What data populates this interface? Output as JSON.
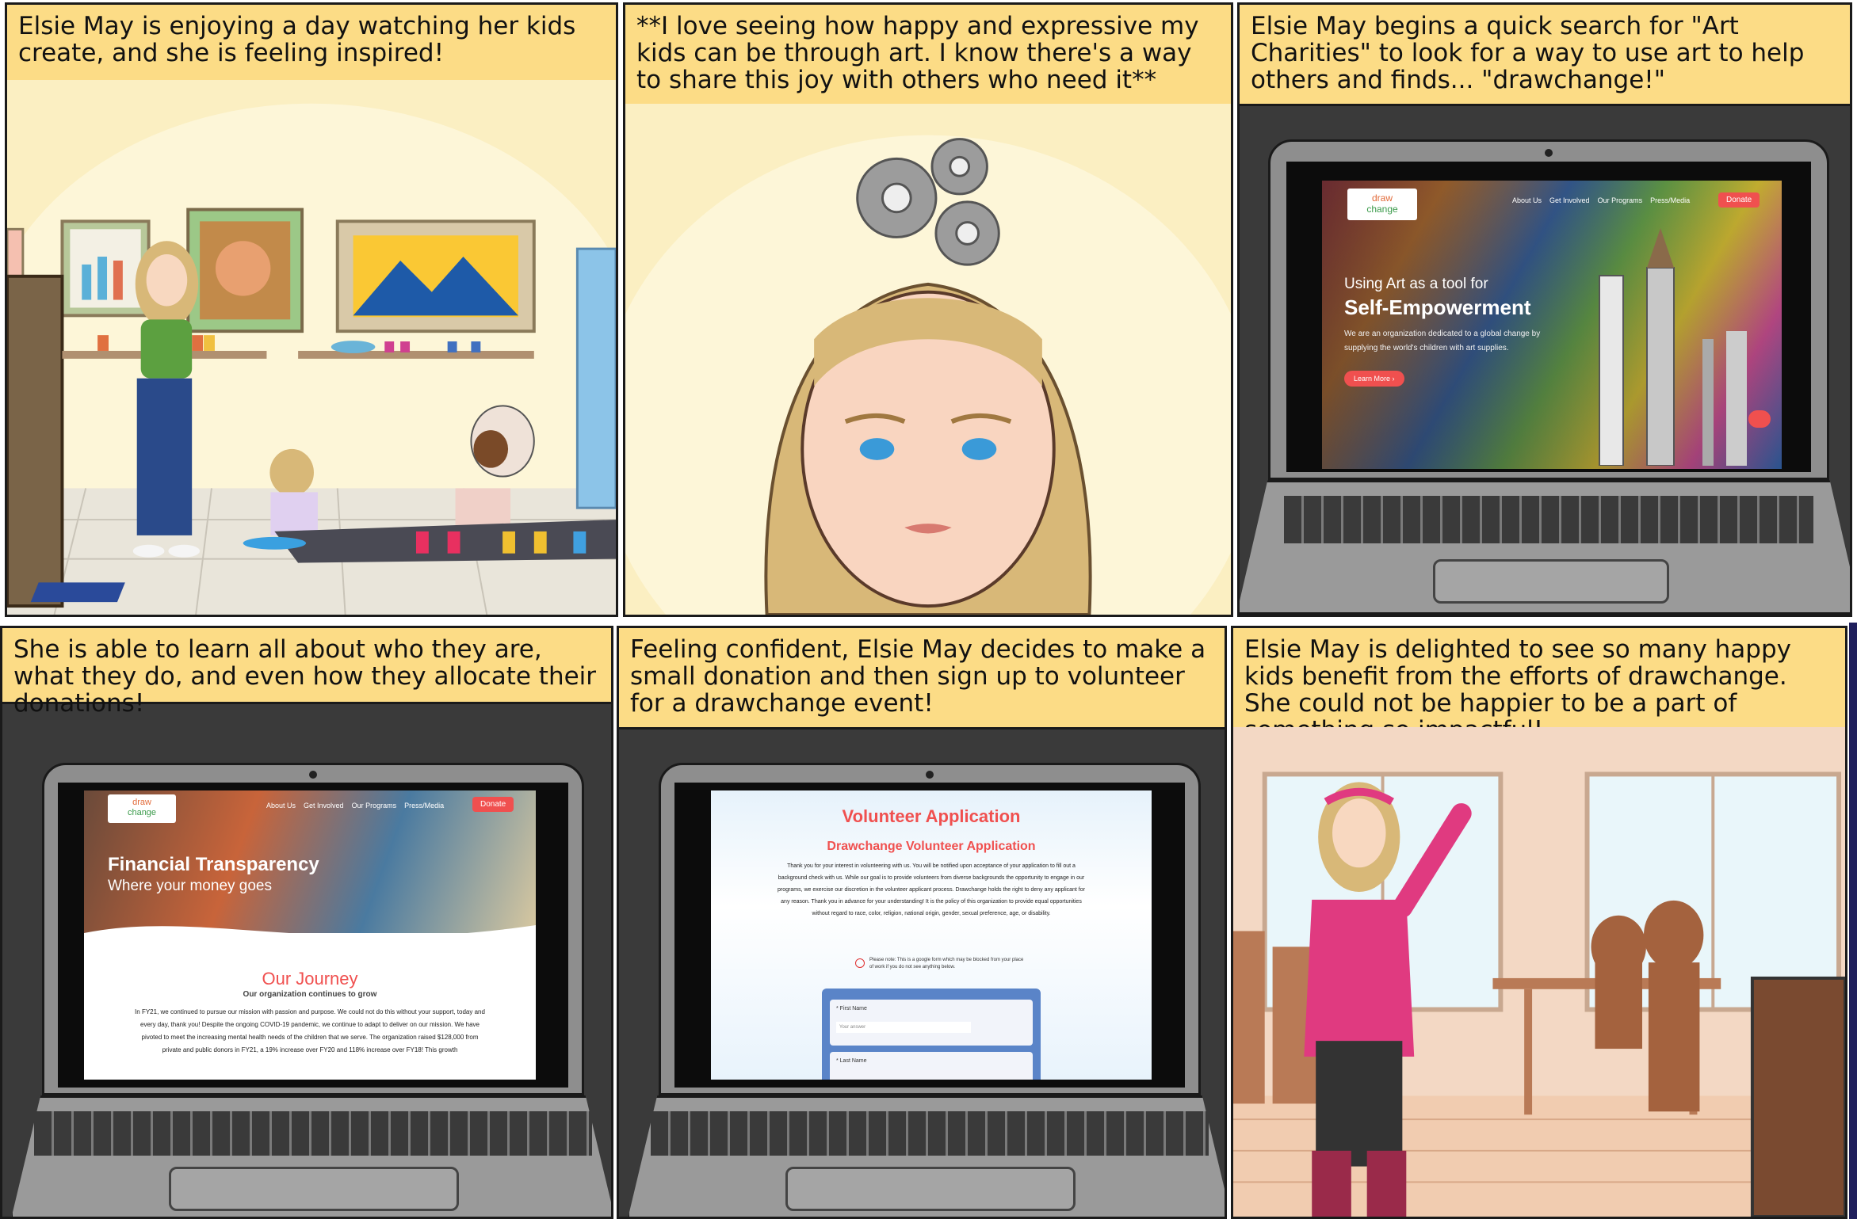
{
  "panels": [
    {
      "caption": "Elsie May is enjoying a day watching her kids create, and she is feeling inspired!"
    },
    {
      "caption": "**I love seeing how happy and expressive my kids can be through art. I know there's a way to share this joy with others who need it**"
    },
    {
      "caption": "Elsie May begins a quick search for \"Art Charities\" to look for a way to use art to help others and finds... \"drawchange!\""
    },
    {
      "caption": "She is able to learn all about who they are, what they do, and even how they allocate their donations!"
    },
    {
      "caption": "Feeling confident, Elsie May decides to make a small donation and then sign up to volunteer for a drawchange event!"
    },
    {
      "caption": "Elsie May is delighted to see so many happy kids benefit from the efforts of drawchange. She could not be happier to be a part of something so impactful!"
    }
  ],
  "site": {
    "logo_line1": "draw",
    "logo_line2": "change",
    "nav": [
      "About Us",
      "Get Involved",
      "Our Programs",
      "Press/Media"
    ],
    "donate": "Donate"
  },
  "hero": {
    "line1": "Using Art as a tool for",
    "line2": "Self-Empowerment",
    "body": "We are an organization dedicated to a global change by supplying the world's children with art supplies.",
    "cta": "Learn More ›"
  },
  "finance": {
    "title": "Financial Transparency",
    "subtitle": "Where your money goes",
    "section_title": "Our Journey",
    "section_sub": "Our organization continues to grow",
    "paragraph": "In FY21, we continued to pursue our mission with passion and purpose. We could not do this without your support, today and every day, thank you! Despite the ongoing COVID-19 pandemic, we continue to adapt to deliver on our mission. We have pivoted to meet the increasing mental health needs of the children that we serve. The organization raised $128,000 from private and public donors in FY21, a 19% increase over FY20 and 118% increase over FY18! This growth"
  },
  "volunteer": {
    "title": "Volunteer Application",
    "subtitle": "Drawchange Volunteer Application",
    "paragraph": "Thank you for your interest in volunteering with us. You will be notified upon acceptance of your application to fill out a background check with us. While our goal is to provide volunteers from diverse backgrounds the opportunity to engage in our programs, we exercise our discretion in the volunteer applicant process. Drawchange holds the right to deny any applicant for any reason. Thank you in advance for your understanding! It is the policy of this organization to provide equal opportunities without regard to race, color, religion, national origin, gender, sexual preference, age, or disability.",
    "note": "Please note: This is a google form which may be blocked from your place of work if you do not see anything below.",
    "field1_label": "* First Name",
    "field1_placeholder": "Your answer",
    "field2_label": "* Last Name"
  },
  "colors": {
    "caption_bg": "#fcdc86",
    "accent": "#f0504f",
    "wall": "#fdf6cf"
  }
}
